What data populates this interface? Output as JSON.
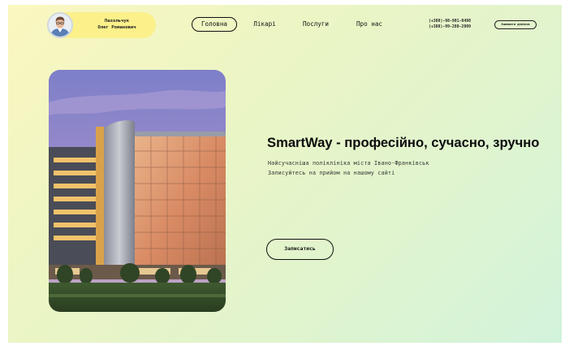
{
  "header": {
    "profile": {
      "name_line1": "Пахольчук",
      "name_line2": "Олег Романович"
    },
    "nav": [
      {
        "label": "Головна",
        "active": true
      },
      {
        "label": "Лікарі",
        "active": false
      },
      {
        "label": "Послуги",
        "active": false
      },
      {
        "label": "Про нас",
        "active": false
      }
    ],
    "phones": [
      "(+380)-98-901-0498",
      "(+380)-99-280-2009"
    ],
    "call_button": "Замовити дзвінок"
  },
  "hero": {
    "title": "SmartWay - професійно, сучасно, зручно",
    "subtitle_line1": "Найсучасніша поліклініка міста Івано-Франківськ",
    "subtitle_line2": "Записуйтесь на прийом на нашому сайті",
    "cta": "Записатись"
  },
  "colors": {
    "background_start": "#fbf7c0",
    "background_end": "#d2f3dc",
    "profile_pill": "#fbf08a",
    "text": "#111111"
  },
  "icons": {
    "avatar": "user-photo",
    "hero_image": "clinic-building-photo"
  }
}
